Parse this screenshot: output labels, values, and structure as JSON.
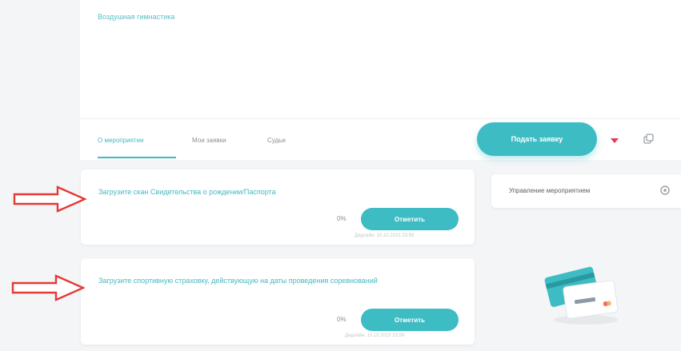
{
  "event": {
    "title": "Воздушная гимнастика"
  },
  "tabs": [
    {
      "label": "О мероприятии",
      "active": true
    },
    {
      "label": "Мои заявки",
      "active": false
    },
    {
      "label": "Судьи",
      "active": false
    }
  ],
  "actions": {
    "apply_label": "Подать заявку",
    "heart_icon": "heart-icon",
    "copy_icon": "copy-icon"
  },
  "documents": [
    {
      "text": "Загрузите скан Свидетельства о рождении/Паспорта",
      "percent": "0%",
      "button_label": "Отметить",
      "deadline": "Дедлайн: 10.10.2023 23:59"
    },
    {
      "text": "Загрузите спортивную страховку, действующую на даты проведения соревнований",
      "percent": "0%",
      "button_label": "Отметить",
      "deadline": "Дедлайн: 10.10.2023 23:59"
    }
  ],
  "sidebar": {
    "manage_label": "Управление мероприятием",
    "settings_icon": "gear-icon"
  },
  "illustration": {
    "card_icon": "credit-card-icon"
  },
  "annotations": {
    "arrow_icon": "red-arrow-icon",
    "arrow_color": "#e53935"
  },
  "colors": {
    "accent": "#3dbcc3",
    "accent_text": "#43b9c2",
    "heart": "#e53950",
    "card_bg": "#ffffff",
    "page_bg": "#f4f5f7"
  }
}
